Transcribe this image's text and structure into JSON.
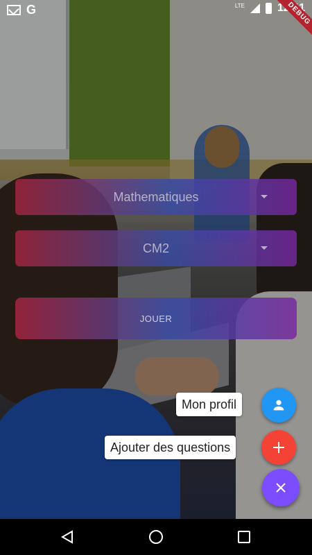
{
  "status_bar": {
    "time": "12:11",
    "network": "LTE",
    "left_icons": [
      "gmail-icon",
      "google-icon"
    ],
    "debug_banner": "DEBUG"
  },
  "subject_dropdown": {
    "selected": "Mathematiques"
  },
  "level_dropdown": {
    "selected": "CM2"
  },
  "play_button": {
    "label": "JOUER"
  },
  "speed_dial": {
    "profile_label": "Mon profil",
    "add_questions_label": "Ajouter des questions",
    "colors": {
      "profile": "#2196f3",
      "add": "#f44336",
      "main": "#7c4dff"
    }
  },
  "navigation_bar": {
    "icons": [
      "back-icon",
      "home-icon",
      "recent-apps-icon"
    ]
  }
}
